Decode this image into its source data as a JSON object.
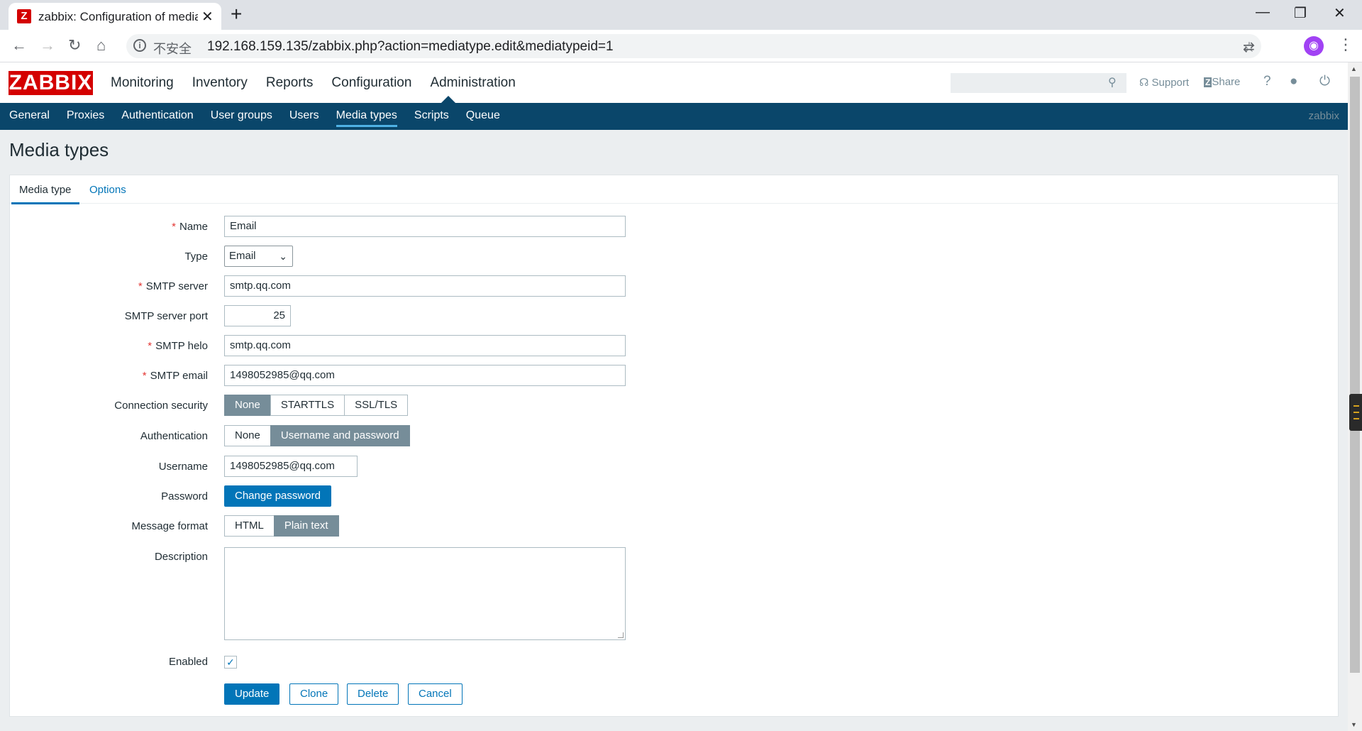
{
  "browser": {
    "tab_title": "zabbix: Configuration of media types",
    "insecure_label": "不安全",
    "url": "192.168.159.135/zabbix.php?action=mediatype.edit&mediatypeid=1"
  },
  "header": {
    "logo": "ZABBIX",
    "menu": [
      "Monitoring",
      "Inventory",
      "Reports",
      "Configuration",
      "Administration"
    ],
    "search_placeholder": "",
    "support": "Support",
    "share": "Share",
    "help": "?"
  },
  "subnav": {
    "items": [
      "General",
      "Proxies",
      "Authentication",
      "User groups",
      "Users",
      "Media types",
      "Scripts",
      "Queue"
    ],
    "active": "Media types",
    "user": "zabbix"
  },
  "page_title": "Media types",
  "tabs": [
    "Media type",
    "Options"
  ],
  "form": {
    "name_label": "Name",
    "name_value": "Email",
    "type_label": "Type",
    "type_value": "Email",
    "smtp_server_label": "SMTP server",
    "smtp_server_value": "smtp.qq.com",
    "smtp_port_label": "SMTP server port",
    "smtp_port_value": "25",
    "smtp_helo_label": "SMTP helo",
    "smtp_helo_value": "smtp.qq.com",
    "smtp_email_label": "SMTP email",
    "smtp_email_value": "1498052985@qq.com",
    "conn_security_label": "Connection security",
    "conn_security_options": [
      "None",
      "STARTTLS",
      "SSL/TLS"
    ],
    "conn_security_selected": "None",
    "auth_label": "Authentication",
    "auth_options": [
      "None",
      "Username and password"
    ],
    "auth_selected": "Username and password",
    "username_label": "Username",
    "username_value": "1498052985@qq.com",
    "password_label": "Password",
    "change_password": "Change password",
    "message_format_label": "Message format",
    "message_format_options": [
      "HTML",
      "Plain text"
    ],
    "message_format_selected": "Plain text",
    "description_label": "Description",
    "description_value": "",
    "enabled_label": "Enabled",
    "enabled_checked": true
  },
  "buttons": {
    "update": "Update",
    "clone": "Clone",
    "delete": "Delete",
    "cancel": "Cancel"
  }
}
